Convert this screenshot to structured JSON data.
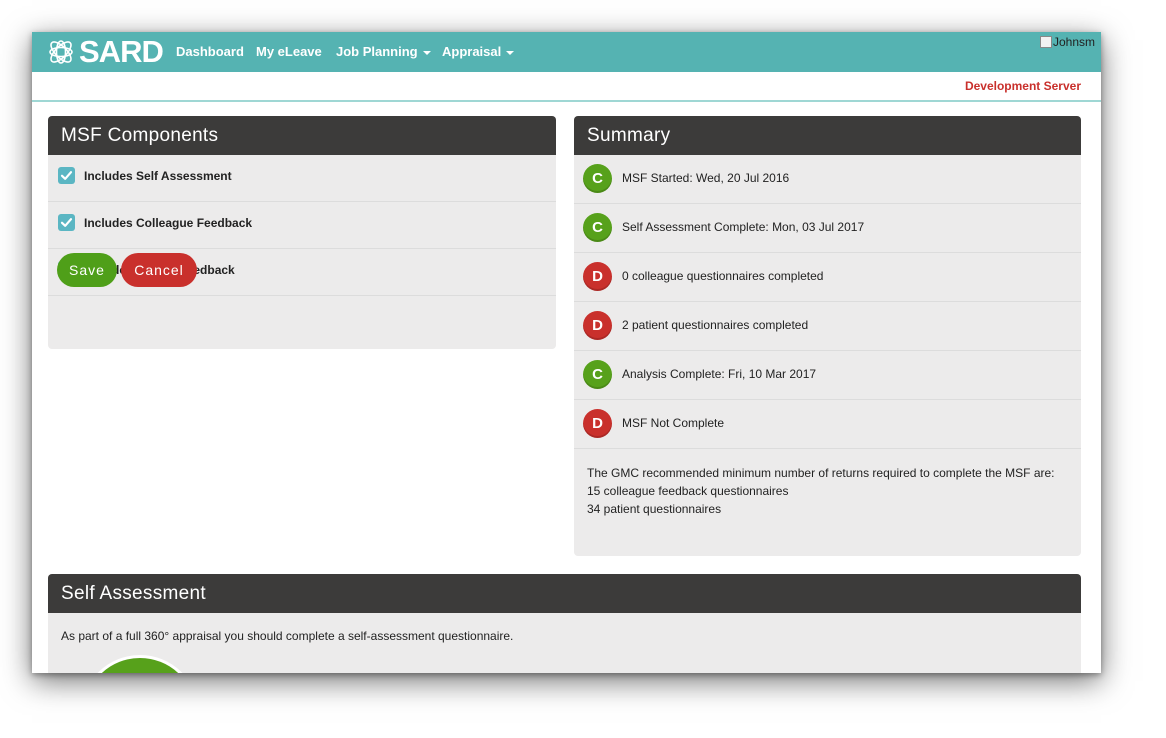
{
  "navbar": {
    "logo_text": "SARD",
    "items": [
      {
        "label": "Dashboard"
      },
      {
        "label": "My eLeave"
      },
      {
        "label": "Job Planning"
      },
      {
        "label": "Appraisal"
      }
    ],
    "user_image_alt": "Johnsm"
  },
  "subbar": {
    "server_label": "Development Server"
  },
  "msf_components": {
    "title": "MSF Components",
    "options": [
      {
        "label": "Includes Self Assessment",
        "checked": true
      },
      {
        "label": "Includes Colleague Feedback",
        "checked": true
      },
      {
        "label": "Includes Patient Feedback",
        "checked": true
      }
    ],
    "save_label": "Save",
    "cancel_label": "Cancel"
  },
  "summary": {
    "title": "Summary",
    "items": [
      {
        "status": "C",
        "text": "MSF Started: Wed, 20 Jul 2016"
      },
      {
        "status": "C",
        "text": "Self Assessment Complete: Mon, 03 Jul 2017"
      },
      {
        "status": "D",
        "text": "0 colleague questionnaires completed"
      },
      {
        "status": "D",
        "text": "2 patient questionnaires completed"
      },
      {
        "status": "C",
        "text": "Analysis Complete: Fri, 10 Mar 2017"
      },
      {
        "status": "D",
        "text": "MSF Not Complete"
      }
    ],
    "note_lines": [
      "The GMC recommended minimum number of returns required to complete the MSF are:",
      "15 colleague feedback questionnaires",
      "34 patient questionnaires"
    ]
  },
  "self_assessment": {
    "title": "Self Assessment",
    "description": "As part of a full 360° appraisal you should complete a self-assessment questionnaire."
  },
  "colors": {
    "navbar": "#55b3b2",
    "panel_header": "#3c3b3a",
    "status_complete": "#57a11b",
    "status_incomplete": "#c9302c",
    "checkbox": "#5bb6c3"
  }
}
